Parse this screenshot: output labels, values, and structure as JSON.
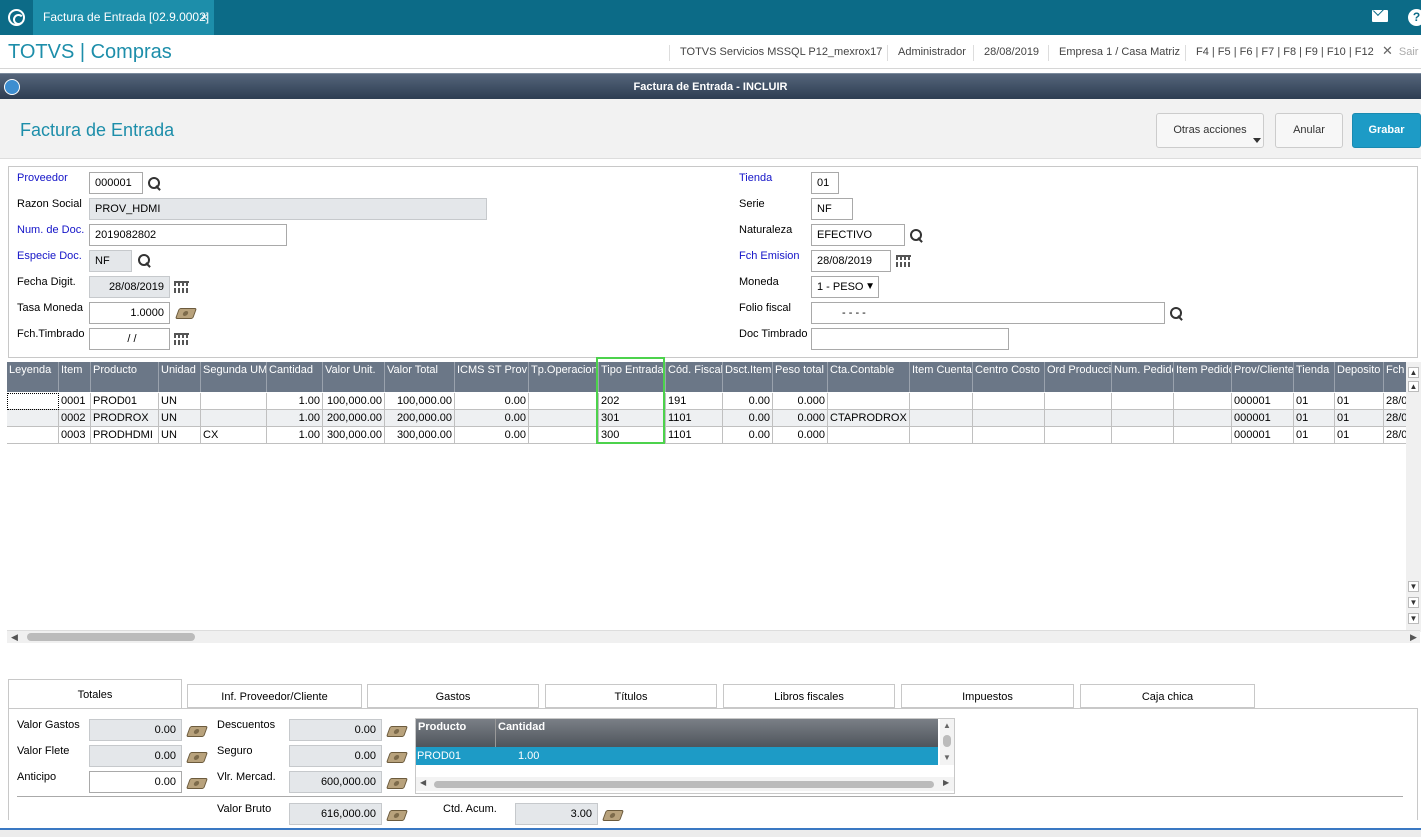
{
  "top": {
    "tab_title": "Factura de Entrada [02.9.0002]",
    "tab_close": "×"
  },
  "header": {
    "app_title": "TOTVS | Compras",
    "env": "TOTVS Servicios MSSQL P12_mexrox17",
    "user": "Administrador",
    "date": "28/08/2019",
    "company": "Empresa 1 / Casa Matriz",
    "keys": "F4 | F5 | F6 | F7 | F8 | F9 | F10 | F12",
    "exit": "Sair"
  },
  "window": {
    "title": "Factura de Entrada - INCLUIR"
  },
  "toolbar": {
    "title": "Factura de Entrada",
    "more": "Otras acciones",
    "cancel": "Anular",
    "save": "Grabar"
  },
  "form": {
    "proveedor": {
      "label": "Proveedor",
      "value": "000001"
    },
    "razon_social": {
      "label": "Razon Social",
      "value": "PROV_HDMI"
    },
    "num_doc": {
      "label": "Num. de Doc.",
      "value": "2019082802"
    },
    "especie": {
      "label": "Especie Doc.",
      "value": "NF"
    },
    "fecha_digit": {
      "label": "Fecha Digit.",
      "value": "28/08/2019"
    },
    "tasa": {
      "label": "Tasa Moneda",
      "value": "1.0000"
    },
    "timbrado": {
      "label": "Fch.Timbrado",
      "value": "/ /"
    },
    "tienda": {
      "label": "Tienda",
      "value": "01"
    },
    "serie": {
      "label": "Serie",
      "value": "NF"
    },
    "naturaleza": {
      "label": "Naturaleza",
      "value": "EFECTIVO"
    },
    "emision": {
      "label": "Fch Emision",
      "value": "28/08/2019"
    },
    "moneda": {
      "label": "Moneda",
      "value": "1 - PESO"
    },
    "folio": {
      "label": "Folio fiscal",
      "value": "-   -   -   -"
    },
    "doc_timbrado": {
      "label": "Doc Timbrado",
      "value": ""
    }
  },
  "grid": {
    "headers": [
      "Leyenda",
      "Item",
      "Producto",
      "Unidad",
      "Segunda UM",
      "Cantidad",
      "Valor Unit.",
      "Valor Total",
      "ICMS ST Prov",
      "Tp.Operacion",
      "Tipo Entrada",
      "Cód. Fiscal",
      "Dsct.Item",
      "Peso total",
      "Cta.Contable",
      "Item Cuenta",
      "Centro Costo",
      "Ord Producci",
      "Num. Pedido",
      "Item Pedido",
      "Prov/Cliente",
      "Tienda",
      "Deposito",
      "Fch"
    ],
    "rows": [
      [
        "",
        "0001",
        "PROD01",
        "UN",
        "",
        "1.00",
        "100,000.00",
        "100,000.00",
        "0.00",
        "",
        "202",
        "191",
        "0.00",
        "0.000",
        "",
        "",
        "",
        "",
        "",
        "",
        "000001",
        "01",
        "01",
        "28/0"
      ],
      [
        "",
        "0002",
        "PRODROX",
        "UN",
        "",
        "1.00",
        "200,000.00",
        "200,000.00",
        "0.00",
        "",
        "301",
        "1101",
        "0.00",
        "0.000",
        "CTAPRODROX",
        "",
        "",
        "",
        "",
        "",
        "000001",
        "01",
        "01",
        "28/0"
      ],
      [
        "",
        "0003",
        "PRODHDMI",
        "UN",
        "CX",
        "1.00",
        "300,000.00",
        "300,000.00",
        "0.00",
        "",
        "300",
        "1101",
        "0.00",
        "0.000",
        "",
        "",
        "",
        "",
        "",
        "",
        "000001",
        "01",
        "01",
        "28/0"
      ]
    ]
  },
  "tabs": [
    "Totales",
    "Inf. Proveedor/Cliente",
    "Gastos",
    "Títulos",
    "Libros fiscales",
    "Impuestos",
    "Caja chica"
  ],
  "totals": {
    "valor_gastos": {
      "label": "Valor Gastos",
      "value": "0.00"
    },
    "valor_flete": {
      "label": "Valor Flete",
      "value": "0.00"
    },
    "anticipo": {
      "label": "Anticipo",
      "value": "0.00"
    },
    "descuentos": {
      "label": "Descuentos",
      "value": "0.00"
    },
    "seguro": {
      "label": "Seguro",
      "value": "0.00"
    },
    "vlr_mercad": {
      "label": "Vlr. Mercad.",
      "value": "600,000.00"
    },
    "valor_bruto": {
      "label": "Valor Bruto",
      "value": "616,000.00"
    },
    "ctd_acum": {
      "label": "Ctd. Acum.",
      "value": "3.00"
    }
  },
  "subgrid": {
    "headers": [
      "Producto",
      "Cantidad"
    ],
    "row": [
      "PROD01",
      "1.00"
    ]
  },
  "colors": {
    "topbar": "#0c6b87",
    "accent": "#1d8eaa",
    "grid_header": "#6b7787",
    "highlight": "#4cd24c",
    "selected_row": "#1d9bc6"
  }
}
